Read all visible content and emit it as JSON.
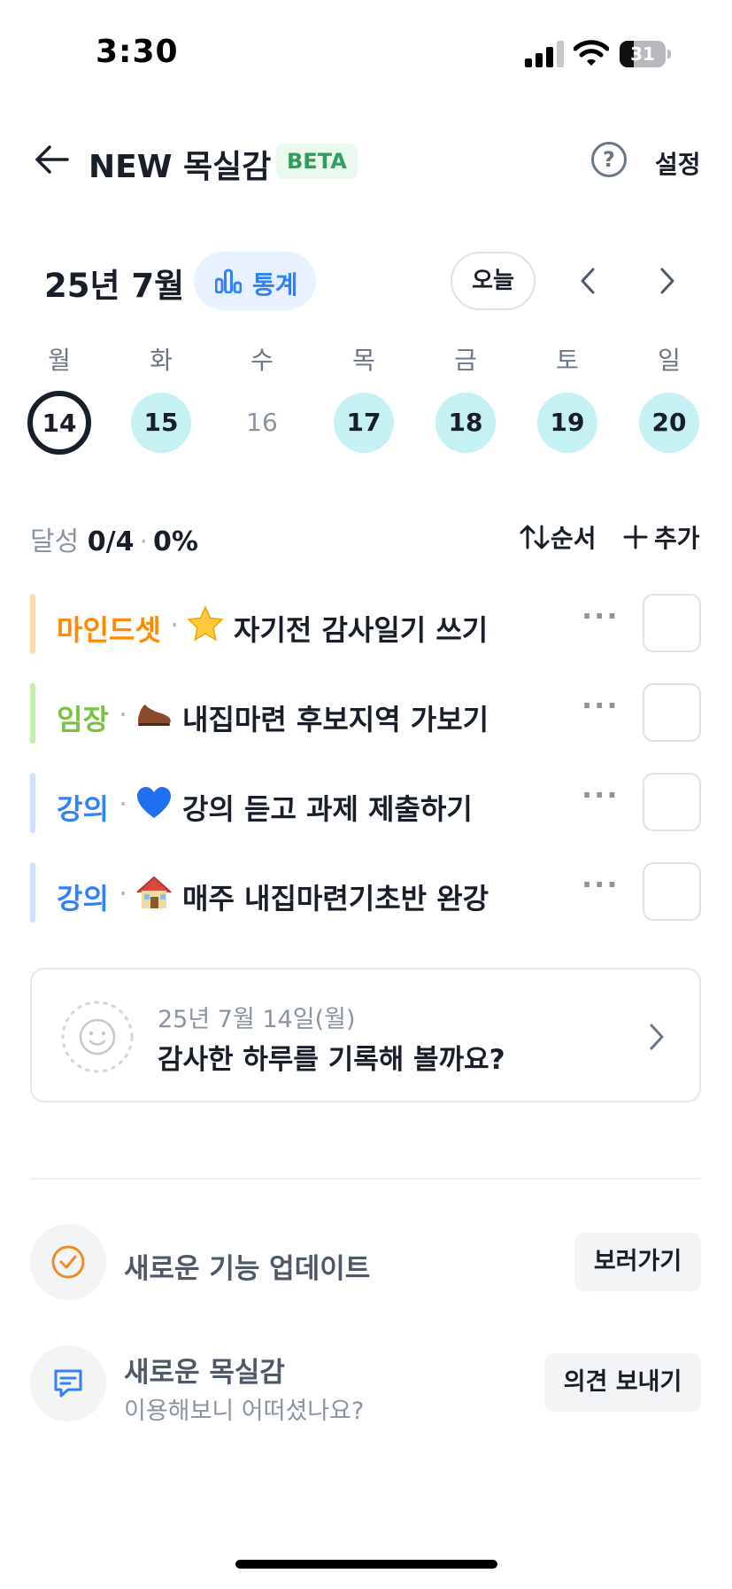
{
  "status_bar": {
    "time": "3:30",
    "battery": "31",
    "battery_level": 0.31
  },
  "header": {
    "title": "NEW 목실감",
    "badge": "BETA",
    "help_icon": "?",
    "settings": "설정"
  },
  "calendar": {
    "month": "25년 7월",
    "stats_label": "통계",
    "today_label": "오늘",
    "weekdays": [
      "월",
      "화",
      "수",
      "목",
      "금",
      "토",
      "일"
    ],
    "days": [
      {
        "num": "14",
        "state": "selected"
      },
      {
        "num": "15",
        "state": "done"
      },
      {
        "num": "16",
        "state": "empty"
      },
      {
        "num": "17",
        "state": "done"
      },
      {
        "num": "18",
        "state": "done"
      },
      {
        "num": "19",
        "state": "done"
      },
      {
        "num": "20",
        "state": "done"
      }
    ]
  },
  "summary": {
    "label": "달성",
    "count": "0/4",
    "percent": "0%",
    "order_label": "순서",
    "add_label": "추가"
  },
  "goals": [
    {
      "category": "마인드셋",
      "color": "#ff8a00",
      "bar_color": "#ffd8a8",
      "emoji": "star-icon",
      "text": "자기전 감사일기 쓰기",
      "more": "···"
    },
    {
      "category": "임장",
      "color": "#7ac142",
      "bar_color": "#c5ecaf",
      "emoji": "shoe-icon",
      "text": "내집마련 후보지역 가보기",
      "more": "···"
    },
    {
      "category": "강의",
      "color": "#3182f6",
      "bar_color": "#cfe0fb",
      "emoji": "blue-heart-icon",
      "text": "강의 듣고 과제 제출하기",
      "more": "···"
    },
    {
      "category": "강의",
      "color": "#3182f6",
      "bar_color": "#cfe0fb",
      "emoji": "house-icon",
      "text": "매주 내집마련기초반 완강",
      "more": "···"
    }
  ],
  "diary": {
    "date": "25년 7월 14일(월)",
    "message": "감사한 하루를 기록해 볼까요?"
  },
  "update": {
    "title": "새로운 기능 업데이트",
    "button": "보러가기"
  },
  "feedback": {
    "title": "새로운 목실감",
    "subtitle": "이용해보니 어떠셨나요?",
    "button": "의견 보내기"
  }
}
